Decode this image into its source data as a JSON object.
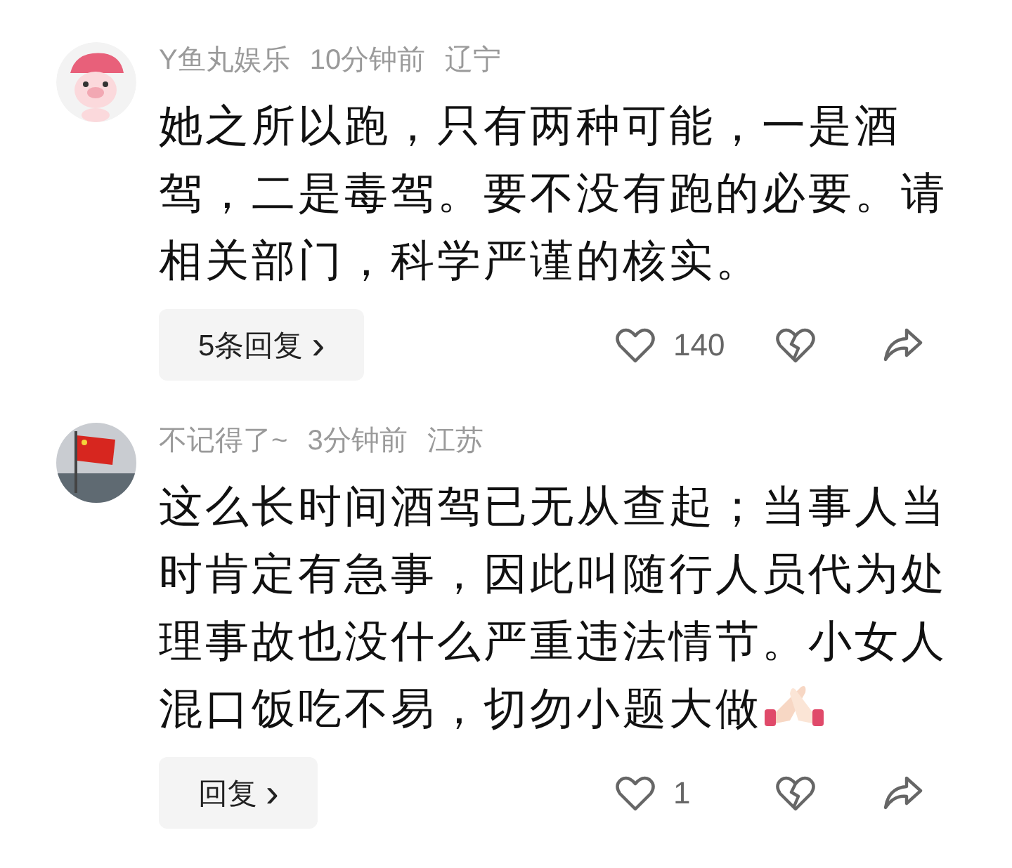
{
  "comments": [
    {
      "avatar": {
        "kind": "pig"
      },
      "user": "Y鱼丸娱乐",
      "time": "10分钟前",
      "region": "辽宁",
      "body": "她之所以跑，只有两种可能，一是酒驾，二是毒驾。要不没有跑的必要。请相关部门，科学严谨的核实。",
      "sticker": false,
      "reply_label": "5条回复",
      "reply_caret": "›",
      "likes": "140"
    },
    {
      "avatar": {
        "kind": "flag"
      },
      "user": "不记得了~",
      "time": "3分钟前",
      "region": "江苏",
      "body": "这么长时间酒驾已无从查起；当事人当时肯定有急事，因此叫随行人员代为处理事故也没什么严重违法情节。小女人混口饭吃不易，切勿小题大做",
      "sticker": true,
      "reply_label": "回复",
      "reply_caret": "›",
      "likes": "1"
    }
  ]
}
